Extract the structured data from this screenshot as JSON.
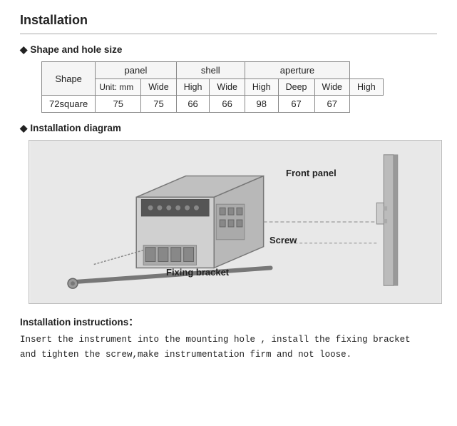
{
  "page": {
    "title": "Installation",
    "section1": {
      "header": "Shape and hole size",
      "table": {
        "col_headers": [
          "Shape",
          "panel",
          "shell",
          "aperture"
        ],
        "col_spans": [
          1,
          2,
          2,
          3
        ],
        "sub_headers": [
          "Unit: mm",
          "Wide",
          "High",
          "Wide",
          "High",
          "Deep",
          "Wide",
          "High"
        ],
        "data_rows": [
          [
            "72square",
            "75",
            "75",
            "66",
            "66",
            "98",
            "67",
            "67"
          ]
        ]
      }
    },
    "section2": {
      "header": "Installation diagram",
      "labels": {
        "front_panel": "Front panel",
        "screw": "Screw",
        "fixing_bracket": "Fixing bracket"
      }
    },
    "section3": {
      "header": "Installation instructions：",
      "text_line1": "Insert the instrument into the mounting hole , install the fixing bracket",
      "text_line2": "and tighten the screw,make instrumentation firm and not loose."
    }
  }
}
